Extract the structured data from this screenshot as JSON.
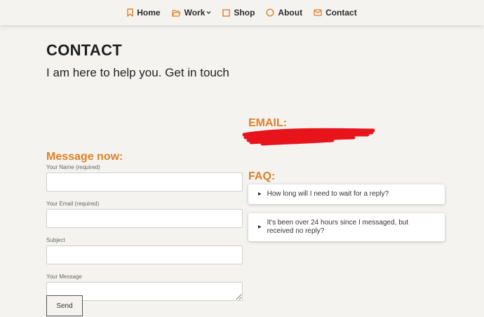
{
  "nav": {
    "items": [
      {
        "label": "Home",
        "icon": "bookmark-icon"
      },
      {
        "label": "Work",
        "icon": "folder-open-icon"
      },
      {
        "label": "Shop",
        "icon": "square-icon"
      },
      {
        "label": "About",
        "icon": "circle-icon"
      },
      {
        "label": "Contact",
        "icon": "envelope-icon"
      }
    ],
    "icon_color": "#dd8128"
  },
  "page": {
    "title": "CONTACT",
    "subtitle": "I am here to help you. Get in touch"
  },
  "email_section": {
    "heading": "EMAIL:",
    "redaction_color": "#e8141c"
  },
  "form": {
    "heading": "Message now:",
    "name_label": "Your Name (required)",
    "email_label": "Your Email (required)",
    "subject_label": "Subject",
    "message_label": "Your Message",
    "send_label": "Send"
  },
  "faq": {
    "heading": "FAQ:",
    "items": [
      "How long will I need to wait for a reply?",
      "It's been over 24 hours since I messaged, but received no reply?"
    ]
  },
  "colors": {
    "accent": "#dd8128",
    "background": "#f4f3f0"
  }
}
